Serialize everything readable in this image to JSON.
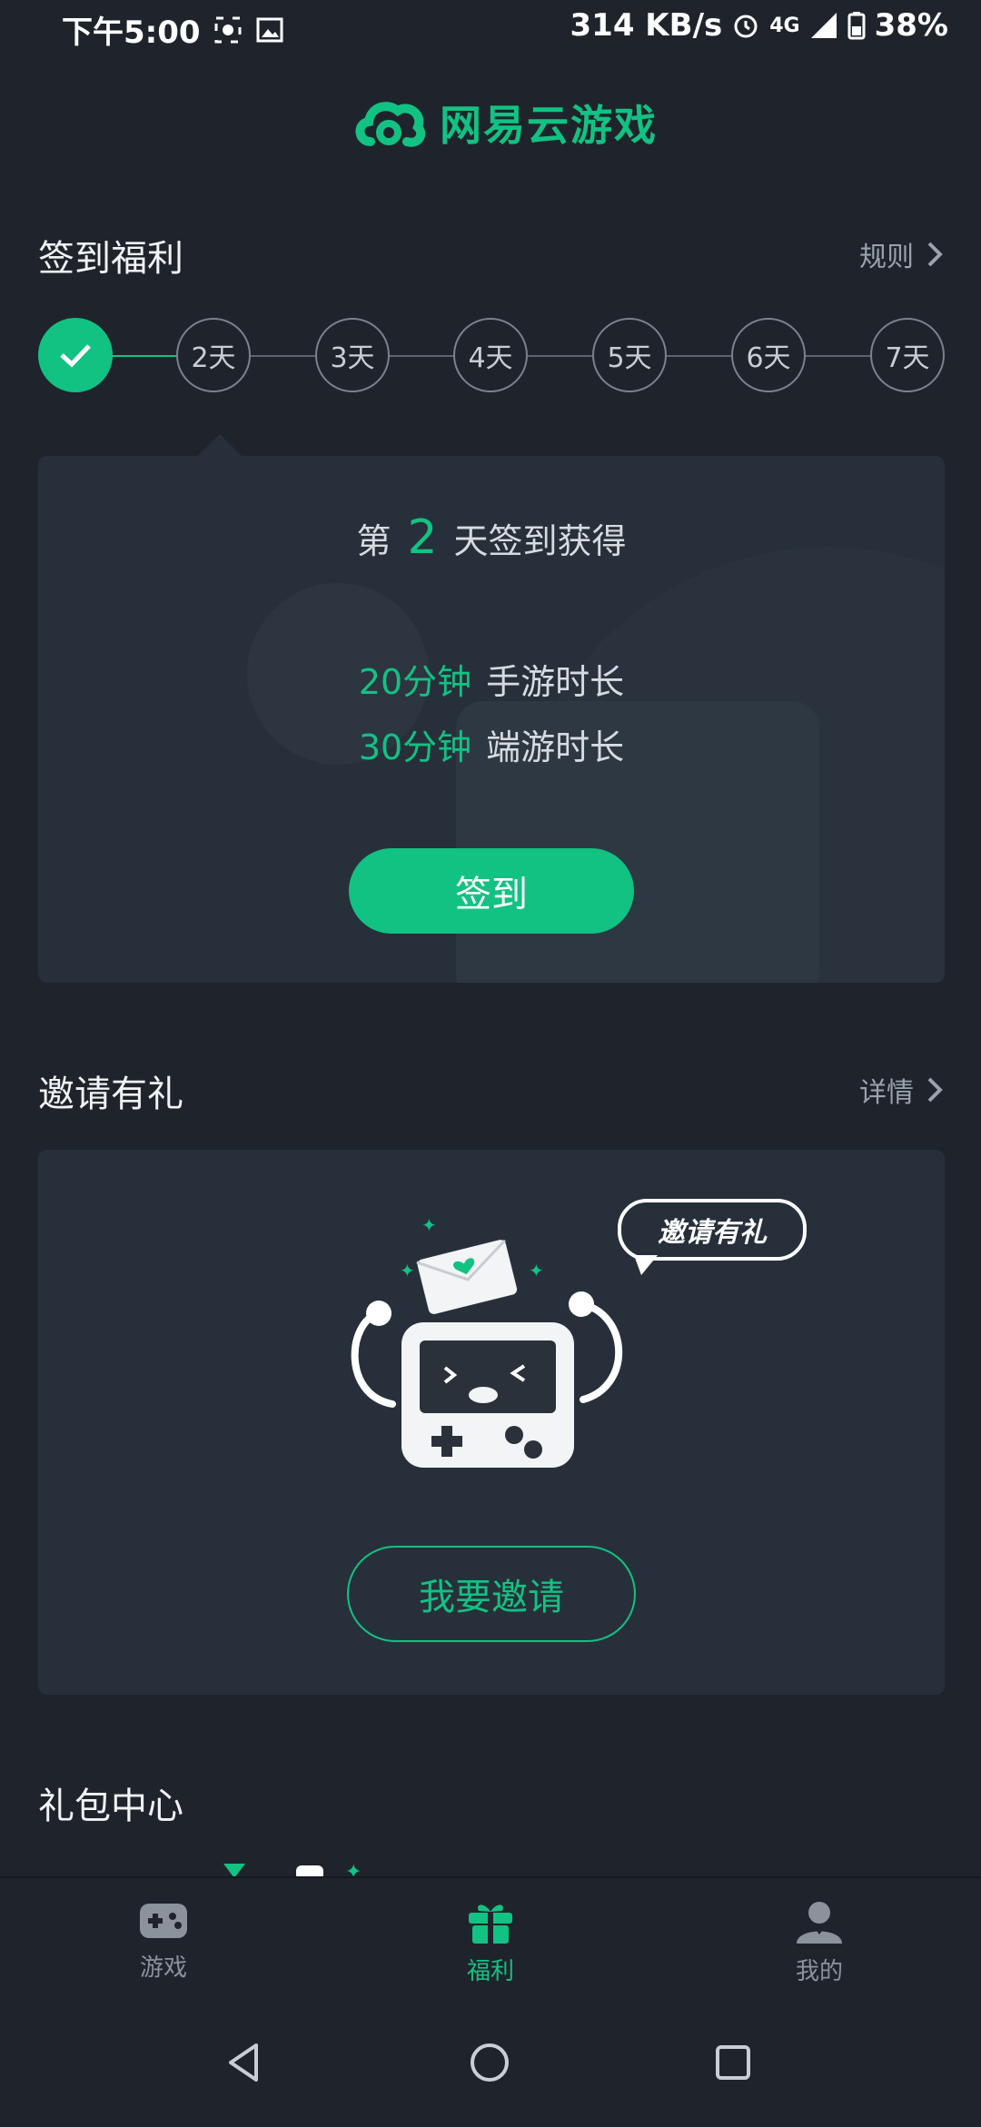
{
  "status_bar": {
    "time": "下午5:00",
    "network_speed": "314 KB/s",
    "network_type": "4G",
    "battery": "38%"
  },
  "app": {
    "logo_text": "网易云游戏"
  },
  "checkin": {
    "title": "签到福利",
    "rules_label": "规则",
    "days": [
      "2天",
      "3天",
      "4天",
      "5天",
      "6天",
      "7天"
    ],
    "reward_prefix": "第",
    "reward_day": "2",
    "reward_suffix": "天签到获得",
    "rewards": [
      {
        "amount": "20分钟",
        "type": "手游时长"
      },
      {
        "amount": "30分钟",
        "type": "端游时长"
      }
    ],
    "button_label": "签到"
  },
  "invite": {
    "title": "邀请有礼",
    "details_label": "详情",
    "bubble_text": "邀请有礼",
    "button_label": "我要邀请"
  },
  "gift_center": {
    "title": "礼包中心"
  },
  "bottom_nav": {
    "items": [
      {
        "label": "游戏",
        "icon": "gamepad-icon"
      },
      {
        "label": "福利",
        "icon": "gift-icon"
      },
      {
        "label": "我的",
        "icon": "user-icon"
      }
    ]
  },
  "colors": {
    "accent": "#12c282",
    "background": "#1f242c",
    "card": "#27303a"
  }
}
